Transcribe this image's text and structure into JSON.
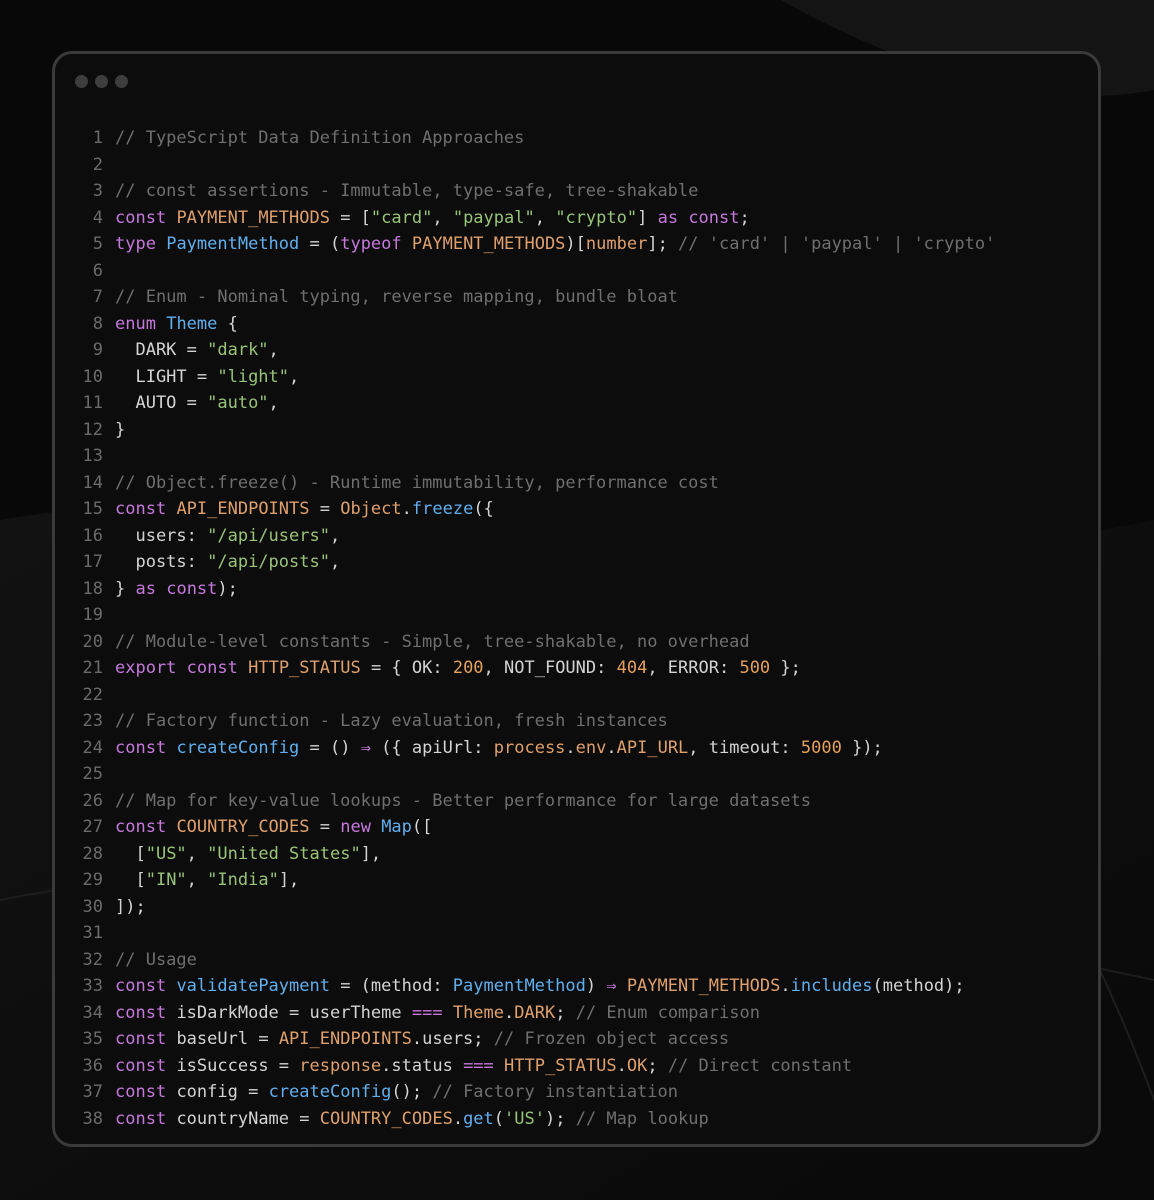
{
  "colors": {
    "background": "#0a0a0a",
    "window": "#0c0c0c",
    "border": "#3a3a3a",
    "line_number": "#6b6b6b",
    "token": {
      "c": "#6f6f6f",
      "k": "#c678dd",
      "v": "#e0a06c",
      "s": "#98c379",
      "n": "#e5a05a",
      "f": "#61afef",
      "t": "#61afef",
      "p": "#d4d4d4",
      "i": "#d4d4d4",
      "o": "#c678dd"
    }
  },
  "window": {
    "controls": [
      "window-dot",
      "window-dot",
      "window-dot"
    ]
  },
  "code_lines": [
    [
      [
        "c",
        "// TypeScript Data Definition Approaches"
      ]
    ],
    [],
    [
      [
        "c",
        "// const assertions - Immutable, type-safe, tree-shakable"
      ]
    ],
    [
      [
        "k",
        "const"
      ],
      [
        "p",
        " "
      ],
      [
        "v",
        "PAYMENT_METHODS"
      ],
      [
        "p",
        " = ["
      ],
      [
        "s",
        "\"card\""
      ],
      [
        "p",
        ", "
      ],
      [
        "s",
        "\"paypal\""
      ],
      [
        "p",
        ", "
      ],
      [
        "s",
        "\"crypto\""
      ],
      [
        "p",
        "] "
      ],
      [
        "k",
        "as"
      ],
      [
        "p",
        " "
      ],
      [
        "k",
        "const"
      ],
      [
        "p",
        ";"
      ]
    ],
    [
      [
        "k",
        "type"
      ],
      [
        "p",
        " "
      ],
      [
        "t",
        "PaymentMethod"
      ],
      [
        "p",
        " = ("
      ],
      [
        "k",
        "typeof"
      ],
      [
        "p",
        " "
      ],
      [
        "v",
        "PAYMENT_METHODS"
      ],
      [
        "p",
        ")["
      ],
      [
        "v",
        "number"
      ],
      [
        "p",
        "]; "
      ],
      [
        "c",
        "// 'card' | 'paypal' | 'crypto'"
      ]
    ],
    [],
    [
      [
        "c",
        "// Enum - Nominal typing, reverse mapping, bundle bloat"
      ]
    ],
    [
      [
        "k",
        "enum"
      ],
      [
        "p",
        " "
      ],
      [
        "t",
        "Theme"
      ],
      [
        "p",
        " {"
      ]
    ],
    [
      [
        "p",
        "  DARK = "
      ],
      [
        "s",
        "\"dark\""
      ],
      [
        "p",
        ","
      ]
    ],
    [
      [
        "p",
        "  LIGHT = "
      ],
      [
        "s",
        "\"light\""
      ],
      [
        "p",
        ","
      ]
    ],
    [
      [
        "p",
        "  AUTO = "
      ],
      [
        "s",
        "\"auto\""
      ],
      [
        "p",
        ","
      ]
    ],
    [
      [
        "p",
        "}"
      ]
    ],
    [],
    [
      [
        "c",
        "// Object.freeze() - Runtime immutability, performance cost"
      ]
    ],
    [
      [
        "k",
        "const"
      ],
      [
        "p",
        " "
      ],
      [
        "v",
        "API_ENDPOINTS"
      ],
      [
        "p",
        " = "
      ],
      [
        "v",
        "Object"
      ],
      [
        "p",
        "."
      ],
      [
        "f",
        "freeze"
      ],
      [
        "p",
        "({"
      ]
    ],
    [
      [
        "p",
        "  users: "
      ],
      [
        "s",
        "\"/api/users\""
      ],
      [
        "p",
        ","
      ]
    ],
    [
      [
        "p",
        "  posts: "
      ],
      [
        "s",
        "\"/api/posts\""
      ],
      [
        "p",
        ","
      ]
    ],
    [
      [
        "p",
        "} "
      ],
      [
        "k",
        "as"
      ],
      [
        "p",
        " "
      ],
      [
        "k",
        "const"
      ],
      [
        "p",
        ");"
      ]
    ],
    [],
    [
      [
        "c",
        "// Module-level constants - Simple, tree-shakable, no overhead"
      ]
    ],
    [
      [
        "k",
        "export"
      ],
      [
        "p",
        " "
      ],
      [
        "k",
        "const"
      ],
      [
        "p",
        " "
      ],
      [
        "v",
        "HTTP_STATUS"
      ],
      [
        "p",
        " = { OK: "
      ],
      [
        "n",
        "200"
      ],
      [
        "p",
        ", NOT_FOUND: "
      ],
      [
        "n",
        "404"
      ],
      [
        "p",
        ", ERROR: "
      ],
      [
        "n",
        "500"
      ],
      [
        "p",
        " };"
      ]
    ],
    [],
    [
      [
        "c",
        "// Factory function - Lazy evaluation, fresh instances"
      ]
    ],
    [
      [
        "k",
        "const"
      ],
      [
        "p",
        " "
      ],
      [
        "f",
        "createConfig"
      ],
      [
        "p",
        " = () "
      ],
      [
        "o",
        "⇒"
      ],
      [
        "p",
        " ({ apiUrl: "
      ],
      [
        "v",
        "process"
      ],
      [
        "p",
        "."
      ],
      [
        "v",
        "env"
      ],
      [
        "p",
        "."
      ],
      [
        "v",
        "API_URL"
      ],
      [
        "p",
        ", timeout: "
      ],
      [
        "n",
        "5000"
      ],
      [
        "p",
        " });"
      ]
    ],
    [],
    [
      [
        "c",
        "// Map for key-value lookups - Better performance for large datasets"
      ]
    ],
    [
      [
        "k",
        "const"
      ],
      [
        "p",
        " "
      ],
      [
        "v",
        "COUNTRY_CODES"
      ],
      [
        "p",
        " = "
      ],
      [
        "k",
        "new"
      ],
      [
        "p",
        " "
      ],
      [
        "t",
        "Map"
      ],
      [
        "p",
        "(["
      ]
    ],
    [
      [
        "p",
        "  ["
      ],
      [
        "s",
        "\"US\""
      ],
      [
        "p",
        ", "
      ],
      [
        "s",
        "\"United States\""
      ],
      [
        "p",
        "],"
      ]
    ],
    [
      [
        "p",
        "  ["
      ],
      [
        "s",
        "\"IN\""
      ],
      [
        "p",
        ", "
      ],
      [
        "s",
        "\"India\""
      ],
      [
        "p",
        "],"
      ]
    ],
    [
      [
        "p",
        "]);"
      ]
    ],
    [],
    [
      [
        "c",
        "// Usage"
      ]
    ],
    [
      [
        "k",
        "const"
      ],
      [
        "p",
        " "
      ],
      [
        "f",
        "validatePayment"
      ],
      [
        "p",
        " = (method: "
      ],
      [
        "t",
        "PaymentMethod"
      ],
      [
        "p",
        ") "
      ],
      [
        "o",
        "⇒"
      ],
      [
        "p",
        " "
      ],
      [
        "v",
        "PAYMENT_METHODS"
      ],
      [
        "p",
        "."
      ],
      [
        "f",
        "includes"
      ],
      [
        "p",
        "(method);"
      ]
    ],
    [
      [
        "k",
        "const"
      ],
      [
        "p",
        " "
      ],
      [
        "i",
        "isDarkMode"
      ],
      [
        "p",
        " = userTheme "
      ],
      [
        "o",
        "==="
      ],
      [
        "p",
        " "
      ],
      [
        "v",
        "Theme"
      ],
      [
        "p",
        "."
      ],
      [
        "v",
        "DARK"
      ],
      [
        "p",
        "; "
      ],
      [
        "c",
        "// Enum comparison"
      ]
    ],
    [
      [
        "k",
        "const"
      ],
      [
        "p",
        " "
      ],
      [
        "i",
        "baseUrl"
      ],
      [
        "p",
        " = "
      ],
      [
        "v",
        "API_ENDPOINTS"
      ],
      [
        "p",
        ".users; "
      ],
      [
        "c",
        "// Frozen object access"
      ]
    ],
    [
      [
        "k",
        "const"
      ],
      [
        "p",
        " "
      ],
      [
        "i",
        "isSuccess"
      ],
      [
        "p",
        " = "
      ],
      [
        "v",
        "response"
      ],
      [
        "p",
        ".status "
      ],
      [
        "o",
        "==="
      ],
      [
        "p",
        " "
      ],
      [
        "v",
        "HTTP_STATUS"
      ],
      [
        "p",
        "."
      ],
      [
        "v",
        "OK"
      ],
      [
        "p",
        "; "
      ],
      [
        "c",
        "// Direct constant"
      ]
    ],
    [
      [
        "k",
        "const"
      ],
      [
        "p",
        " "
      ],
      [
        "i",
        "config"
      ],
      [
        "p",
        " = "
      ],
      [
        "f",
        "createConfig"
      ],
      [
        "p",
        "(); "
      ],
      [
        "c",
        "// Factory instantiation"
      ]
    ],
    [
      [
        "k",
        "const"
      ],
      [
        "p",
        " "
      ],
      [
        "i",
        "countryName"
      ],
      [
        "p",
        " = "
      ],
      [
        "v",
        "COUNTRY_CODES"
      ],
      [
        "p",
        "."
      ],
      [
        "f",
        "get"
      ],
      [
        "p",
        "("
      ],
      [
        "s",
        "'US'"
      ],
      [
        "p",
        "); "
      ],
      [
        "c",
        "// Map lookup"
      ]
    ]
  ]
}
